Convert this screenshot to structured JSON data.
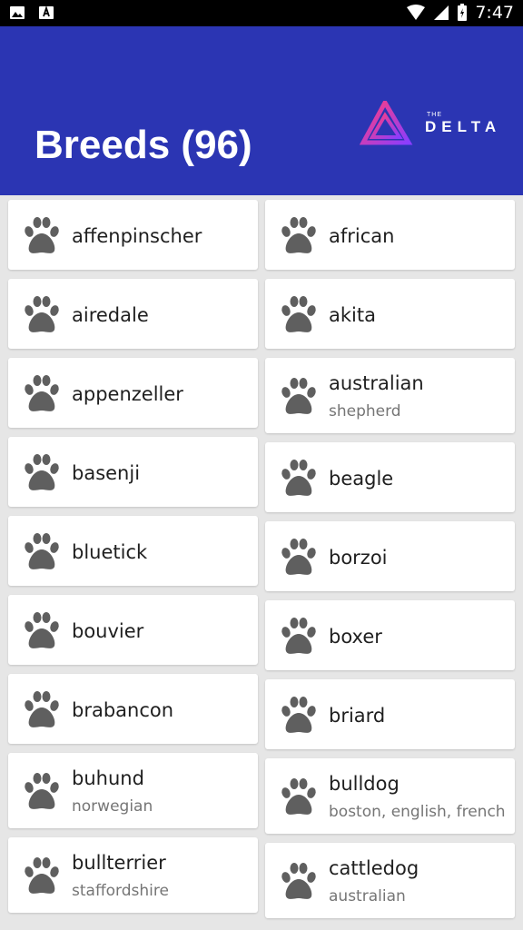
{
  "status": {
    "time": "7:47"
  },
  "header": {
    "title": "Breeds (96)",
    "logo_small": "THE",
    "logo_text": "DELTA"
  },
  "colors": {
    "app_bar": "#2b35b3",
    "paw": "#5f5f5f"
  },
  "breeds_left": [
    {
      "name": "affenpinscher",
      "sub": ""
    },
    {
      "name": "airedale",
      "sub": ""
    },
    {
      "name": "appenzeller",
      "sub": ""
    },
    {
      "name": "basenji",
      "sub": ""
    },
    {
      "name": "bluetick",
      "sub": ""
    },
    {
      "name": "bouvier",
      "sub": ""
    },
    {
      "name": "brabancon",
      "sub": ""
    },
    {
      "name": "buhund",
      "sub": "norwegian"
    },
    {
      "name": "bullterrier",
      "sub": "staffordshire"
    }
  ],
  "breeds_right": [
    {
      "name": "african",
      "sub": ""
    },
    {
      "name": "akita",
      "sub": ""
    },
    {
      "name": "australian",
      "sub": "shepherd"
    },
    {
      "name": "beagle",
      "sub": ""
    },
    {
      "name": "borzoi",
      "sub": ""
    },
    {
      "name": "boxer",
      "sub": ""
    },
    {
      "name": "briard",
      "sub": ""
    },
    {
      "name": "bulldog",
      "sub": "boston, english, french"
    },
    {
      "name": "cattledog",
      "sub": "australian"
    }
  ]
}
